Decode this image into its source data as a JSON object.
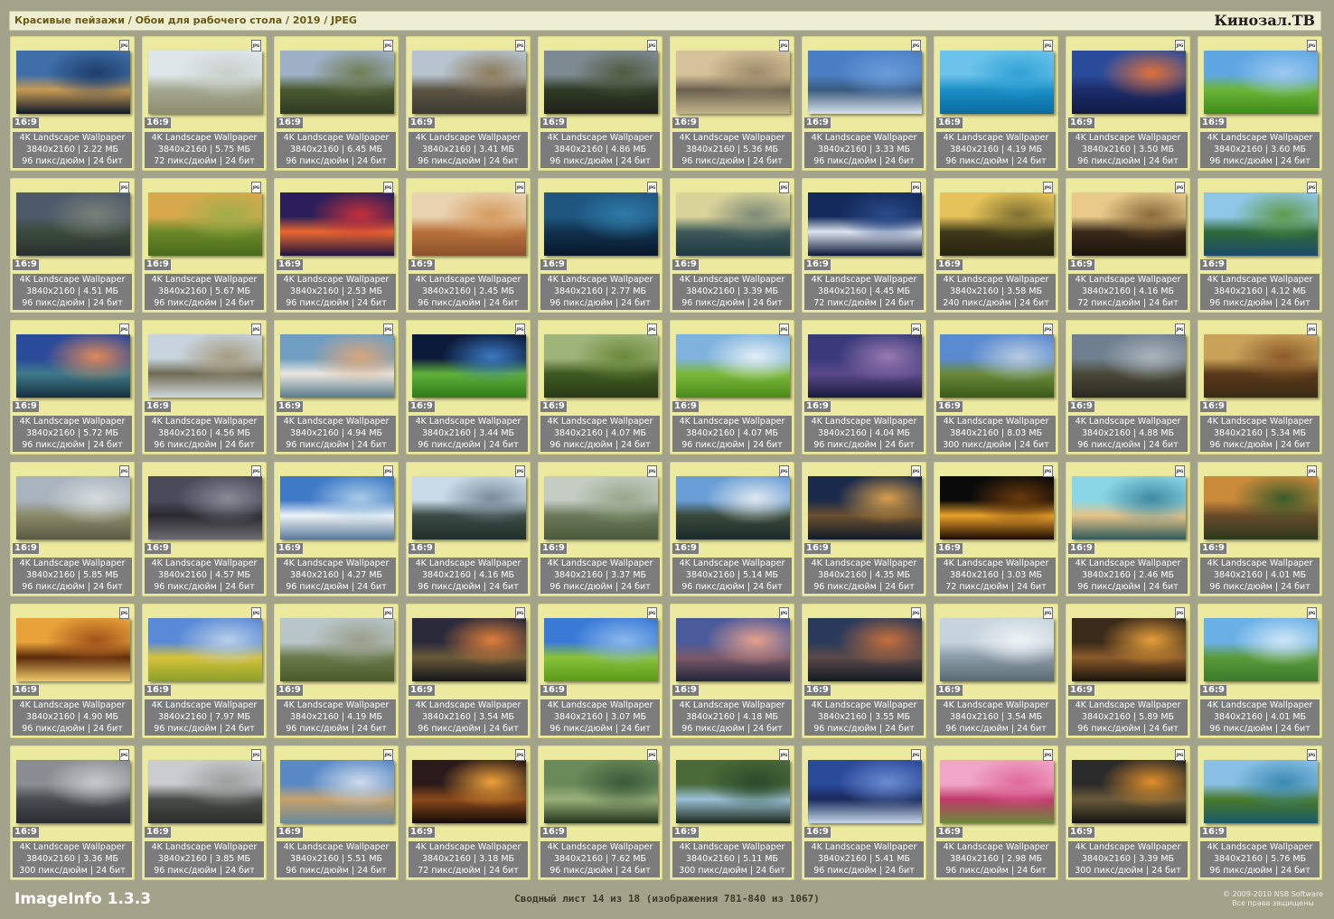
{
  "header": {
    "breadcrumb": "Красивые пейзажи / Обои для рабочего стола / 2019 / JPEG",
    "brand": "Кинозал.ТВ"
  },
  "tile_labels": {
    "badge": "JPG",
    "aspect": "16:9",
    "resolution": "3840x2160",
    "bit_depth": "24 бит"
  },
  "items": [
    {
      "name": "4K Landscape Wallpaper",
      "size": "2.22 МБ",
      "dpi": "96 пикс/дюйм",
      "colors": [
        "#3f6ea8",
        "#1d3d6a",
        "#c79a52",
        "#0e1a2c"
      ]
    },
    {
      "name": "4K Landscape Wallpaper",
      "size": "5.75 МБ",
      "dpi": "72 пикс/дюйм",
      "colors": [
        "#dfe6ea",
        "#c9cfc9",
        "#a3a88f",
        "#8d8d70"
      ]
    },
    {
      "name": "4K Landscape Wallpaper",
      "size": "6.45 МБ",
      "dpi": "96 пикс/дюйм",
      "colors": [
        "#9fb1c7",
        "#6f7d54",
        "#4a5a32",
        "#2f3a22"
      ]
    },
    {
      "name": "4K Landscape Wallpaper",
      "size": "3.41 МБ",
      "dpi": "96 пикс/дюйм",
      "colors": [
        "#b7c4cf",
        "#8b7a5a",
        "#5d5444",
        "#3d3a33"
      ]
    },
    {
      "name": "4K Landscape Wallpaper",
      "size": "4.86 МБ",
      "dpi": "96 пикс/дюйм",
      "colors": [
        "#7e8a92",
        "#4f5b3e",
        "#2f3a25",
        "#1f221c"
      ]
    },
    {
      "name": "4K Landscape Wallpaper",
      "size": "5.36 МБ",
      "dpi": "96 пикс/дюйм",
      "colors": [
        "#d6c29a",
        "#9c8a6a",
        "#6b6250",
        "#c4b48c"
      ]
    },
    {
      "name": "4K Landscape Wallpaper",
      "size": "3.33 МБ",
      "dpi": "96 пикс/дюйм",
      "colors": [
        "#4b7fc5",
        "#6a9bd8",
        "#3a5a7e",
        "#d8e2ec"
      ]
    },
    {
      "name": "4K Landscape Wallpaper",
      "size": "4.19 МБ",
      "dpi": "96 пикс/дюйм",
      "colors": [
        "#6cc3ea",
        "#2fa2d5",
        "#1a8ec6",
        "#0b6c9e"
      ]
    },
    {
      "name": "4K Landscape Wallpaper",
      "size": "3.50 МБ",
      "dpi": "96 пикс/дюйм",
      "colors": [
        "#2b4c9a",
        "#e0703a",
        "#1d2d6a",
        "#0f1a44"
      ]
    },
    {
      "name": "4K Landscape Wallpaper",
      "size": "3.60 МБ",
      "dpi": "96 пикс/дюйм",
      "colors": [
        "#5fa6e3",
        "#9cc9ef",
        "#6bb536",
        "#3f8a1a"
      ]
    },
    {
      "name": "4K Landscape Wallpaper",
      "size": "4.51 МБ",
      "dpi": "96 пикс/дюйм",
      "colors": [
        "#4d5a6a",
        "#7a7f77",
        "#3b4b3b",
        "#2a3030"
      ]
    },
    {
      "name": "4K Landscape Wallpaper",
      "size": "5.67 МБ",
      "dpi": "96 пикс/дюйм",
      "colors": [
        "#d7a94c",
        "#9fae4a",
        "#6b8a2a",
        "#4a6a1c"
      ]
    },
    {
      "name": "4K Landscape Wallpaper",
      "size": "2.53 МБ",
      "dpi": "96 пикс/дюйм",
      "colors": [
        "#2a1f5a",
        "#c4303a",
        "#e9672f",
        "#1d1540"
      ]
    },
    {
      "name": "4K Landscape Wallpaper",
      "size": "2.45 МБ",
      "dpi": "96 пикс/дюйм",
      "colors": [
        "#ead3b0",
        "#d59a5e",
        "#b9733e",
        "#8c522a"
      ]
    },
    {
      "name": "4K Landscape Wallpaper",
      "size": "2.77 МБ",
      "dpi": "96 пикс/дюйм",
      "colors": [
        "#1e5680",
        "#2f7aa8",
        "#12324f",
        "#08182a"
      ]
    },
    {
      "name": "4K Landscape Wallpaper",
      "size": "3.39 МБ",
      "dpi": "96 пикс/дюйм",
      "colors": [
        "#d9d49a",
        "#7d8a77",
        "#3e5a5a",
        "#1f3a42"
      ]
    },
    {
      "name": "4K Landscape Wallpaper",
      "size": "4.45 МБ",
      "dpi": "72 пикс/дюйм",
      "colors": [
        "#132a5a",
        "#2a4a8a",
        "#dde4ef",
        "#0c1838"
      ]
    },
    {
      "name": "4K Landscape Wallpaper",
      "size": "3.58 МБ",
      "dpi": "240 пикс/дюйм",
      "colors": [
        "#e6c25a",
        "#7c7030",
        "#3f3a1a",
        "#26230f"
      ]
    },
    {
      "name": "4K Landscape Wallpaper",
      "size": "4.16 МБ",
      "dpi": "72 пикс/дюйм",
      "colors": [
        "#e8c98a",
        "#8a6a3a",
        "#3a2a1a",
        "#1d140c"
      ]
    },
    {
      "name": "4K Landscape Wallpaper",
      "size": "4.12 МБ",
      "dpi": "96 пикс/дюйм",
      "colors": [
        "#8fc7e6",
        "#5f9a4a",
        "#2f6a3a",
        "#1c4a6a"
      ]
    },
    {
      "name": "4K Landscape Wallpaper",
      "size": "5.72 МБ",
      "dpi": "96 пикс/дюйм",
      "colors": [
        "#2a4a9a",
        "#e08a5a",
        "#3f7a8a",
        "#173040"
      ]
    },
    {
      "name": "4K Landscape Wallpaper",
      "size": "4.56 МБ",
      "dpi": "96 пикс/дюйм",
      "colors": [
        "#c7d4dd",
        "#a69b7e",
        "#6f6a54",
        "#d2d9dc"
      ]
    },
    {
      "name": "4K Landscape Wallpaper",
      "size": "4.94 МБ",
      "dpi": "96 пикс/дюйм",
      "colors": [
        "#6f9ec2",
        "#d8a67a",
        "#eae6df",
        "#5a7a8a"
      ]
    },
    {
      "name": "4K Landscape Wallpaper",
      "size": "3.44 МБ",
      "dpi": "96 пикс/дюйм",
      "colors": [
        "#0c1a3a",
        "#3a7ac2",
        "#5fb03a",
        "#2f7a1a"
      ]
    },
    {
      "name": "4K Landscape Wallpaper",
      "size": "4.07 МБ",
      "dpi": "96 пикс/дюйм",
      "colors": [
        "#9fb47a",
        "#6a8a3a",
        "#3f5a22",
        "#2a3a16"
      ]
    },
    {
      "name": "4K Landscape Wallpaper",
      "size": "4.07 МБ",
      "dpi": "96 пикс/дюйм",
      "colors": [
        "#7fb3dd",
        "#e3eef4",
        "#7bb83a",
        "#4a8a1a"
      ]
    },
    {
      "name": "4K Landscape Wallpaper",
      "size": "4.04 МБ",
      "dpi": "96 пикс/дюйм",
      "colors": [
        "#3a3a7a",
        "#9a7ab0",
        "#5a4a8a",
        "#1a1a3a"
      ]
    },
    {
      "name": "4K Landscape Wallpaper",
      "size": "8.03 МБ",
      "dpi": "300 пикс/дюйм",
      "colors": [
        "#5a8ad0",
        "#b7cbe0",
        "#6b8a3a",
        "#3a5a1a"
      ]
    },
    {
      "name": "4K Landscape Wallpaper",
      "size": "4.88 МБ",
      "dpi": "96 пикс/дюйм",
      "colors": [
        "#6f7f8f",
        "#a9b3ba",
        "#4a4a3a",
        "#2a2a22"
      ]
    },
    {
      "name": "4K Landscape Wallpaper",
      "size": "5.34 МБ",
      "dpi": "96 пикс/дюйм",
      "colors": [
        "#c9a25a",
        "#8a5a2a",
        "#5a3a1a",
        "#3a2a14"
      ]
    },
    {
      "name": "4K Landscape Wallpaper",
      "size": "5.85 МБ",
      "dpi": "96 пикс/дюйм",
      "colors": [
        "#a8b3bd",
        "#d6dadb",
        "#8a8a6a",
        "#5a5a44"
      ]
    },
    {
      "name": "4K Landscape Wallpaper",
      "size": "4.57 МБ",
      "dpi": "96 пикс/дюйм",
      "colors": [
        "#4a4a5a",
        "#8a8a96",
        "#2a2a30",
        "#6a6a70"
      ]
    },
    {
      "name": "4K Landscape Wallpaper",
      "size": "4.27 МБ",
      "dpi": "96 пикс/дюйм",
      "colors": [
        "#3f7ac6",
        "#a8cbe6",
        "#eef3f6",
        "#5a7a9a"
      ]
    },
    {
      "name": "4K Landscape Wallpaper",
      "size": "4.16 МБ",
      "dpi": "96 пикс/дюйм",
      "colors": [
        "#c9dbe9",
        "#7a8a9a",
        "#3a4a44",
        "#22302a"
      ]
    },
    {
      "name": "4K Landscape Wallpaper",
      "size": "3.37 МБ",
      "dpi": "96 пикс/дюйм",
      "colors": [
        "#c4ccc4",
        "#9aa68a",
        "#6a7a5a",
        "#4a5a3a"
      ]
    },
    {
      "name": "4K Landscape Wallpaper",
      "size": "5.14 МБ",
      "dpi": "96 пикс/дюйм",
      "colors": [
        "#6a9ed6",
        "#dfe7ee",
        "#3a4a3a",
        "#1a2a2a"
      ]
    },
    {
      "name": "4K Landscape Wallpaper",
      "size": "4.35 МБ",
      "dpi": "96 пикс/дюйм",
      "colors": [
        "#1a2a4a",
        "#d9a04a",
        "#6a5030",
        "#121a2a"
      ]
    },
    {
      "name": "4K Landscape Wallpaper",
      "size": "3.03 МБ",
      "dpi": "72 пикс/дюйм",
      "colors": [
        "#0a0a0a",
        "#6a3a0a",
        "#e9a02a",
        "#1a0a04"
      ]
    },
    {
      "name": "4K Landscape Wallpaper",
      "size": "2.46 МБ",
      "dpi": "96 пикс/дюйм",
      "colors": [
        "#8ad6e6",
        "#3f8aa0",
        "#e6c48a",
        "#2f5a5a"
      ]
    },
    {
      "name": "4K Landscape Wallpaper",
      "size": "4.01 МБ",
      "dpi": "96 пикс/дюйм",
      "colors": [
        "#c98a3a",
        "#3a5a2a",
        "#6a4a2a",
        "#2a3a1a"
      ]
    },
    {
      "name": "4K Landscape Wallpaper",
      "size": "4.90 МБ",
      "dpi": "96 пикс/дюйм",
      "colors": [
        "#e8a23a",
        "#a0521a",
        "#5a2a0a",
        "#f0c86a"
      ]
    },
    {
      "name": "4K Landscape Wallpaper",
      "size": "7.97 МБ",
      "dpi": "96 пикс/дюйм",
      "colors": [
        "#5a8ad6",
        "#b8cfe8",
        "#d6c23a",
        "#8aa02a"
      ]
    },
    {
      "name": "4K Landscape Wallpaper",
      "size": "4.19 МБ",
      "dpi": "96 пикс/дюйм",
      "colors": [
        "#b9c6c9",
        "#9a9e8a",
        "#6a7a4a",
        "#4a5a2a"
      ]
    },
    {
      "name": "4K Landscape Wallpaper",
      "size": "3.54 МБ",
      "dpi": "96 пикс/дюйм",
      "colors": [
        "#2a2a3a",
        "#e0803a",
        "#6a5a3a",
        "#14141a"
      ]
    },
    {
      "name": "4K Landscape Wallpaper",
      "size": "3.07 МБ",
      "dpi": "96 пикс/дюйм",
      "colors": [
        "#3a7ad6",
        "#8ab8ec",
        "#8ac23a",
        "#5a9a1a"
      ]
    },
    {
      "name": "4K Landscape Wallpaper",
      "size": "4.18 МБ",
      "dpi": "96 пикс/дюйм",
      "colors": [
        "#4a5a9a",
        "#e7a08a",
        "#7a5a6a",
        "#22263a"
      ]
    },
    {
      "name": "4K Landscape Wallpaper",
      "size": "3.55 МБ",
      "dpi": "96 пикс/дюйм",
      "colors": [
        "#2a3a5a",
        "#c9703a",
        "#5a4a4a",
        "#141a24"
      ]
    },
    {
      "name": "4K Landscape Wallpaper",
      "size": "3.54 МБ",
      "dpi": "96 пикс/дюйм",
      "colors": [
        "#c6d4dd",
        "#eef2f4",
        "#8a9aa6",
        "#5a6a74"
      ]
    },
    {
      "name": "4K Landscape Wallpaper",
      "size": "5.89 МБ",
      "dpi": "96 пикс/дюйм",
      "colors": [
        "#3a2a1a",
        "#e8a03a",
        "#8a5a2a",
        "#1a140c"
      ]
    },
    {
      "name": "4K Landscape Wallpaper",
      "size": "4.01 МБ",
      "dpi": "96 пикс/дюйм",
      "colors": [
        "#6ab0e6",
        "#cfe6f6",
        "#5a9a3a",
        "#3a7a2a"
      ]
    },
    {
      "name": "4K Landscape Wallpaper",
      "size": "3.36 МБ",
      "dpi": "300 пикс/дюйм",
      "colors": [
        "#8a8e92",
        "#c6c9cc",
        "#4a4e52",
        "#2a2e32"
      ]
    },
    {
      "name": "4K Landscape Wallpaper",
      "size": "3.85 МБ",
      "dpi": "96 пикс/дюйм",
      "colors": [
        "#c9cdcf",
        "#9a9e9c",
        "#4a4e4a",
        "#2a2e2a"
      ]
    },
    {
      "name": "4K Landscape Wallpaper",
      "size": "5.51 МБ",
      "dpi": "96 пикс/дюйм",
      "colors": [
        "#5a8ac6",
        "#cfdcea",
        "#c6a06a",
        "#6a8a9a"
      ]
    },
    {
      "name": "4K Landscape Wallpaper",
      "size": "3.18 МБ",
      "dpi": "72 пикс/дюйм",
      "colors": [
        "#2a1a1a",
        "#f0a23a",
        "#8a4a1a",
        "#140a0a"
      ]
    },
    {
      "name": "4K Landscape Wallpaper",
      "size": "7.62 МБ",
      "dpi": "96 пикс/дюйм",
      "colors": [
        "#6a8a5a",
        "#3a5a3a",
        "#9ab07a",
        "#22361e"
      ]
    },
    {
      "name": "4K Landscape Wallpaper",
      "size": "5.11 МБ",
      "dpi": "300 пикс/дюйм",
      "colors": [
        "#4a6a3a",
        "#2a4a2a",
        "#9ac0d6",
        "#1a2a1a"
      ]
    },
    {
      "name": "4K Landscape Wallpaper",
      "size": "5.41 МБ",
      "dpi": "96 пикс/дюйм",
      "colors": [
        "#2a4a9a",
        "#6a8ad0",
        "#1a2a5a",
        "#c6d6ea"
      ]
    },
    {
      "name": "4K Landscape Wallpaper",
      "size": "2.98 МБ",
      "dpi": "96 пикс/дюйм",
      "colors": [
        "#f0a6c6",
        "#e06a9a",
        "#c03a6a",
        "#6a8a3a"
      ]
    },
    {
      "name": "4K Landscape Wallpaper",
      "size": "3.39 МБ",
      "dpi": "300 пикс/дюйм",
      "colors": [
        "#2a2a2a",
        "#e0902a",
        "#6a5a3a",
        "#141414"
      ]
    },
    {
      "name": "4K Landscape Wallpaper",
      "size": "5.76 МБ",
      "dpi": "96 пикс/дюйм",
      "colors": [
        "#8ac0e6",
        "#3a8ab0",
        "#4a7a2a",
        "#1a5a6a"
      ]
    }
  ],
  "footer": {
    "app": "ImageInfo 1.3.3",
    "sheet": "Сводный лист 14 из 18 (изображения 781-840 из 1067)",
    "copyright_line1": "© 2009-2010 NSB Software",
    "copyright_line2": "Все права защищены"
  }
}
